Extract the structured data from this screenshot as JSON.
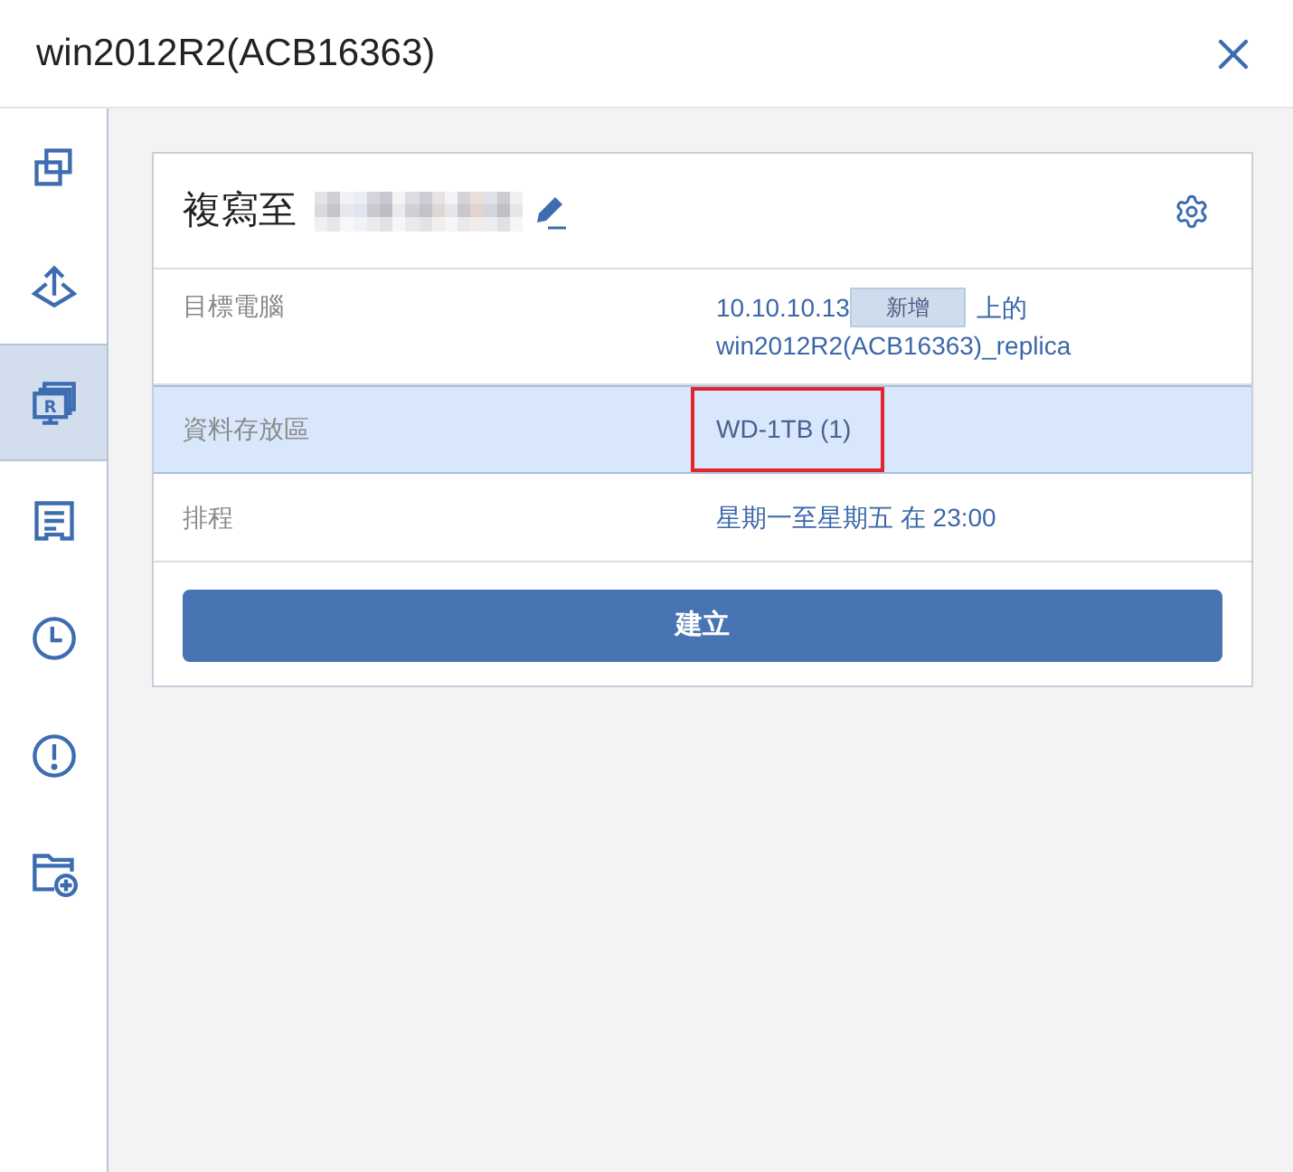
{
  "window": {
    "title": "win2012R2(ACB16363)"
  },
  "sidebar": {
    "items": [
      {
        "kind": "overlap",
        "selected": false
      },
      {
        "kind": "upload",
        "selected": false
      },
      {
        "kind": "replica",
        "letter": "R",
        "selected": true
      },
      {
        "kind": "document",
        "selected": false
      },
      {
        "kind": "clock",
        "selected": false
      },
      {
        "kind": "alert",
        "selected": false
      },
      {
        "kind": "folder-add",
        "selected": false
      }
    ]
  },
  "card": {
    "title": "複寫至",
    "rows": [
      {
        "kind": "target",
        "label": "目標電腦",
        "address": "10.10.10.13",
        "button": "新增",
        "suffix": "上的",
        "name": "win2012R2(ACB16363)_replica",
        "selected": false,
        "annotated": false
      },
      {
        "kind": "text",
        "label": "資料存放區",
        "value": "WD-1TB (1)",
        "selected": true,
        "annotated": true
      },
      {
        "kind": "text",
        "label": "排程",
        "value": "星期一至星期五 在 23:00",
        "selected": false,
        "annotated": false
      }
    ],
    "action": "建立"
  }
}
